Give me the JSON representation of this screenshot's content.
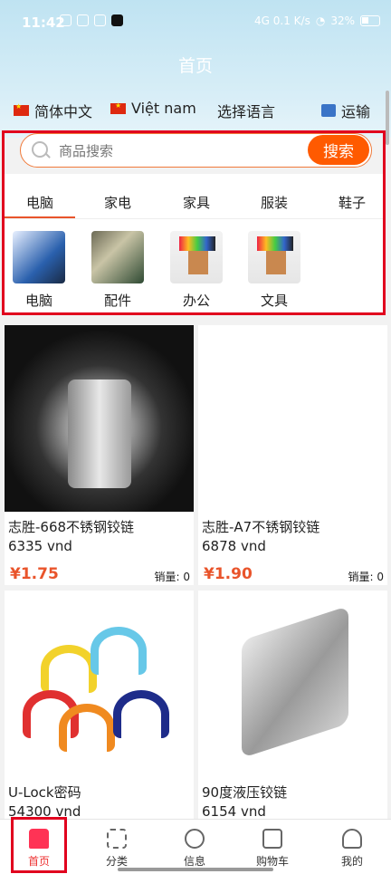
{
  "status": {
    "time": "11:42",
    "net": "4G 0.1 K/s",
    "battery": "32%"
  },
  "header": {
    "title": "首页"
  },
  "languages": [
    {
      "label": "简体中文"
    },
    {
      "label": "Việt nam"
    }
  ],
  "lang_select": "选择语言",
  "shipping": "运输",
  "search": {
    "placeholder": "商品搜索",
    "button": "搜索"
  },
  "tabs": [
    "电脑",
    "家电",
    "家具",
    "服装",
    "鞋子"
  ],
  "categories": [
    {
      "label": "电脑"
    },
    {
      "label": "配件"
    },
    {
      "label": "办公"
    },
    {
      "label": "文具"
    }
  ],
  "products": [
    {
      "name": "志胜-668不锈钢铰链",
      "vnd": "6335 vnd",
      "price": "¥1.75",
      "sold": "销量: 0"
    },
    {
      "name": "志胜-A7不锈钢铰链",
      "vnd": "6878 vnd",
      "price": "¥1.90",
      "sold": "销量: 0"
    },
    {
      "name": "U-Lock密码",
      "vnd": "54300 vnd",
      "price": "",
      "sold": ""
    },
    {
      "name": "90度液压铰链",
      "vnd": "6154 vnd",
      "price": "",
      "sold": ""
    }
  ],
  "tabbar": [
    "首页",
    "分类",
    "信息",
    "购物车",
    "我的"
  ],
  "colors": {
    "accent": "#ff5a00",
    "highlight": "#e1001e",
    "price": "#e9542b"
  }
}
